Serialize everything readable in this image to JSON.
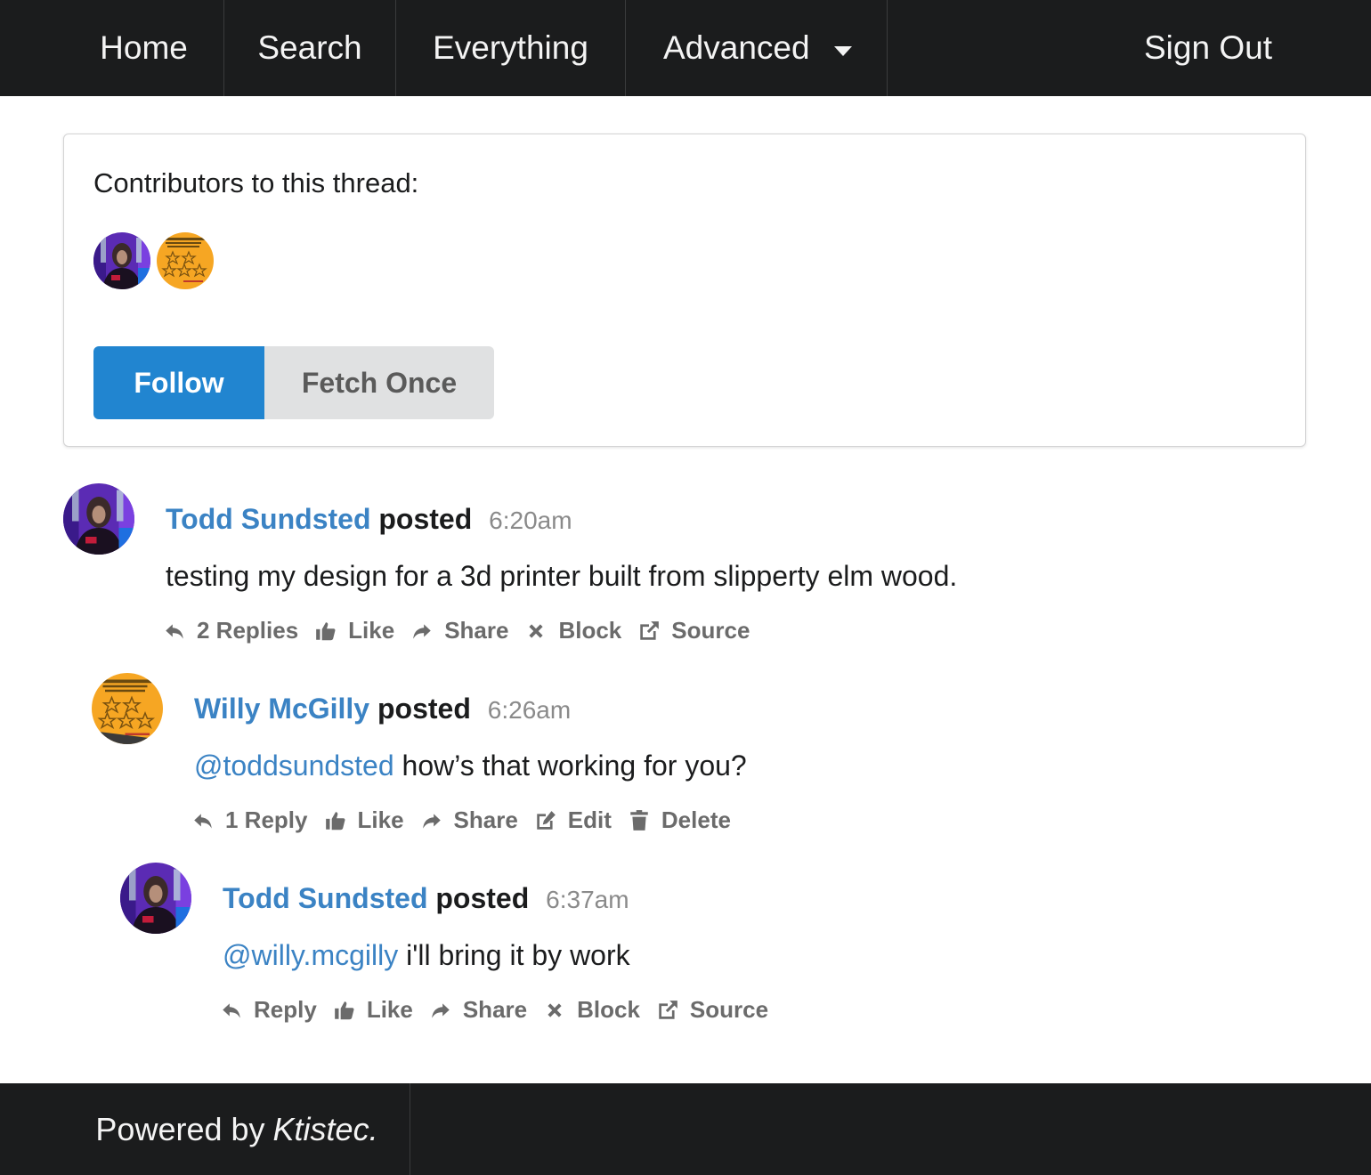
{
  "nav": {
    "home": "Home",
    "search": "Search",
    "everything": "Everything",
    "advanced": "Advanced",
    "sign_out": "Sign Out"
  },
  "contributors": {
    "title": "Contributors to this thread:",
    "follow_label": "Follow",
    "fetch_once_label": "Fetch Once"
  },
  "posts": [
    {
      "author": "Todd Sundsted",
      "verb": "posted",
      "time": "6:20am",
      "body": "testing my design for a 3d printer built from slipperty elm wood.",
      "actions": [
        "2 Replies",
        "Like",
        "Share",
        "Block",
        "Source"
      ]
    },
    {
      "author": "Willy McGilly",
      "verb": "posted",
      "time": "6:26am",
      "mention": "@toddsundsted",
      "body": " how’s that working for you?",
      "actions": [
        "1 Reply",
        "Like",
        "Share",
        "Edit",
        "Delete"
      ]
    },
    {
      "author": "Todd Sundsted",
      "verb": "posted",
      "time": "6:37am",
      "mention": "@willy.mcgilly",
      "body": " i'll bring it by work",
      "actions": [
        "Reply",
        "Like",
        "Share",
        "Block",
        "Source"
      ]
    }
  ],
  "footer": {
    "powered_by": "Powered by",
    "brand": "Ktistec."
  },
  "colors": {
    "nav_bg": "#1b1c1d",
    "primary": "#2185d0",
    "link": "#3b83c4",
    "muted": "#6b6b6b"
  },
  "icons": {
    "reply": "reply-icon",
    "like": "thumbs-up-icon",
    "share": "share-icon",
    "block": "close-icon",
    "source": "external-link-icon",
    "edit": "edit-icon",
    "delete": "trash-icon"
  }
}
